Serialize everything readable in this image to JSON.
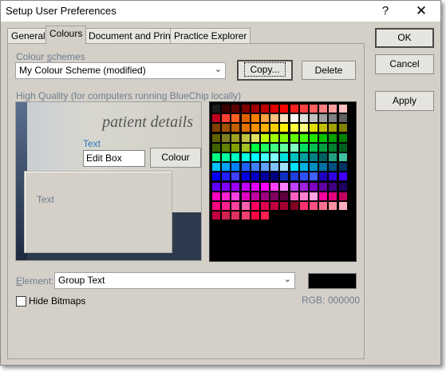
{
  "window": {
    "title": "Setup User Preferences",
    "help_glyph": "?",
    "close_glyph": "✕"
  },
  "tabs": [
    {
      "label": "General",
      "active": false
    },
    {
      "label": "Colours",
      "active": true
    },
    {
      "label": "Document and Print",
      "active": false
    },
    {
      "label": "Practice Explorer",
      "active": false
    }
  ],
  "dialog_buttons": {
    "ok": "OK",
    "cancel": "Cancel",
    "apply": "Apply"
  },
  "colour_schemes": {
    "label_pre": "Colour ",
    "label_u": "s",
    "label_post": "chemes",
    "selected": "My Colour Scheme (modified)",
    "copy_label": "Copy...",
    "delete_label": "Delete"
  },
  "high_quality_label": "High Quality (for computers running BlueChip locally)",
  "preview": {
    "heading": "patient details",
    "text_label": "Text",
    "edit_box_value": "Edit Box",
    "colour_button": "Colour",
    "inner_text": "Text"
  },
  "palette_colors": [
    "#1a1a1a",
    "#3a0000",
    "#5c0000",
    "#800000",
    "#a00000",
    "#c00000",
    "#e00000",
    "#ff0000",
    "#ff2020",
    "#ff4040",
    "#ff6060",
    "#ff8080",
    "#ffa0a0",
    "#ffc0c0",
    "#c00020",
    "#ff4030",
    "#ff6020",
    "#e06000",
    "#ff8000",
    "#ffa040",
    "#ffc080",
    "#ffe0c0",
    "#ffffff",
    "#e0e0e0",
    "#c0c0c0",
    "#a0a0a0",
    "#808080",
    "#606060",
    "#804000",
    "#a05000",
    "#c06000",
    "#e07000",
    "#ff9000",
    "#ffb000",
    "#ffd000",
    "#fff000",
    "#ffff40",
    "#ffff80",
    "#e0e000",
    "#c0c000",
    "#a0a000",
    "#808000",
    "#606000",
    "#808020",
    "#a0a020",
    "#c0c040",
    "#e0e060",
    "#c0ff00",
    "#a0ff00",
    "#80ff00",
    "#60ff00",
    "#40ff00",
    "#20e000",
    "#00c000",
    "#00a000",
    "#008000",
    "#406000",
    "#608000",
    "#80a000",
    "#a0c020",
    "#00ff40",
    "#20ff60",
    "#40ff80",
    "#60ffa0",
    "#80ffc0",
    "#00e060",
    "#00c050",
    "#00a040",
    "#008030",
    "#006020",
    "#00ff80",
    "#00ffa0",
    "#00ffc0",
    "#00ffe0",
    "#00ffff",
    "#40ffff",
    "#80ffff",
    "#00e0e0",
    "#00c0c0",
    "#00a0a0",
    "#008080",
    "#006060",
    "#20a080",
    "#40c0a0",
    "#00c0ff",
    "#00a0ff",
    "#0080ff",
    "#2060ff",
    "#4080ff",
    "#60a0ff",
    "#80c0ff",
    "#a0e0ff",
    "#00e0ff",
    "#00b0e0",
    "#0090c0",
    "#0070a0",
    "#005080",
    "#003060",
    "#0000ff",
    "#2020ff",
    "#4040ff",
    "#0000e0",
    "#0000c0",
    "#0000a0",
    "#000080",
    "#1030c0",
    "#2040e0",
    "#3050ff",
    "#4060ff",
    "#2000c0",
    "#3000e0",
    "#4000ff",
    "#6000ff",
    "#8000ff",
    "#a000ff",
    "#c000ff",
    "#e000ff",
    "#ff00ff",
    "#ff40ff",
    "#ff80ff",
    "#c040ff",
    "#a020e0",
    "#8000c0",
    "#6000a0",
    "#400080",
    "#200060",
    "#ff00c0",
    "#ff20d0",
    "#ff40e0",
    "#e000c0",
    "#c000a0",
    "#a00080",
    "#800060",
    "#600040",
    "#ff60c0",
    "#ff80d0",
    "#ffa0e0",
    "#ff00a0",
    "#e00080",
    "#c00060",
    "#ff0080",
    "#ff2090",
    "#ff40a0",
    "#ff60b0",
    "#ff0060",
    "#e00050",
    "#c00040",
    "#a00030",
    "#800020",
    "#ff3070",
    "#ff5080",
    "#ff7090",
    "#ff90a0",
    "#ffb0c0",
    "#c00040",
    "#d02050",
    "#e03060",
    "#f04070",
    "#ff0040",
    "#ff2050"
  ],
  "element": {
    "label_u": "E",
    "label_post": "lement:",
    "selected": "Group Text",
    "color": "#000000"
  },
  "hide_bitmaps": {
    "label": "Hide Bitmaps",
    "checked": false
  },
  "rgb": {
    "label": "RGB:",
    "value": "000000"
  }
}
